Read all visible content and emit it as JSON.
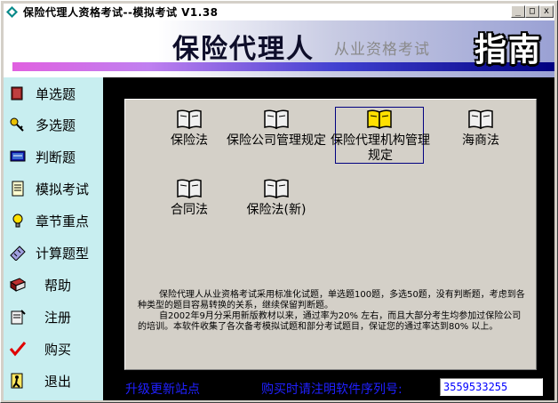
{
  "window": {
    "title": "保险代理人资格考试--模拟考试 V1.38",
    "min_label": "_",
    "max_label": "□",
    "close_label": "x"
  },
  "banner": {
    "main_text": "保险代理人",
    "sub_text": "从业资格考试",
    "logo_text": "指南"
  },
  "sidebar": {
    "items": [
      {
        "label": "单选题",
        "icon": "book-icon"
      },
      {
        "label": "多选题",
        "icon": "key-icon"
      },
      {
        "label": "判断题",
        "icon": "monitor-icon"
      },
      {
        "label": "模拟考试",
        "icon": "document-icon"
      },
      {
        "label": "章节重点",
        "icon": "lightbulb-icon"
      },
      {
        "label": "计算题型",
        "icon": "ruler-icon"
      },
      {
        "label": "帮助",
        "icon": "help-book-icon"
      },
      {
        "label": "注册",
        "icon": "register-icon"
      },
      {
        "label": "购买",
        "icon": "checkmark-icon"
      },
      {
        "label": "退出",
        "icon": "exit-door-icon"
      }
    ]
  },
  "books": [
    {
      "label": "保险法"
    },
    {
      "label": "保险公司管理规定"
    },
    {
      "label": "保险代理机构管理规定",
      "selected": true
    },
    {
      "label": "海商法"
    },
    {
      "label": "合同法"
    },
    {
      "label": "保险法(新)"
    }
  ],
  "description": {
    "para1": "保险代理人从业资格考试采用标准化试题，单选题100题，多选50题，没有判断题，考虑到各种类型的题目容易转换的关系，继续保留判断题。",
    "para2": "自2002年9月分采用新版教材以来，通过率为20% 左右，而且大部分考生均参加过保险公司的培训。本软件收集了各次备考模拟试题和部分考试题目，保证您的通过率达到80% 以上。"
  },
  "footer": {
    "upgrade_link": "升级更新站点",
    "purchase_note": "购买时请注明软件序列号:",
    "serial": "3559533255"
  },
  "colors": {
    "sidebar_bg": "#c8eef0",
    "main_bg": "#000000",
    "link_blue": "#2020ff",
    "selected_border": "#000080"
  }
}
